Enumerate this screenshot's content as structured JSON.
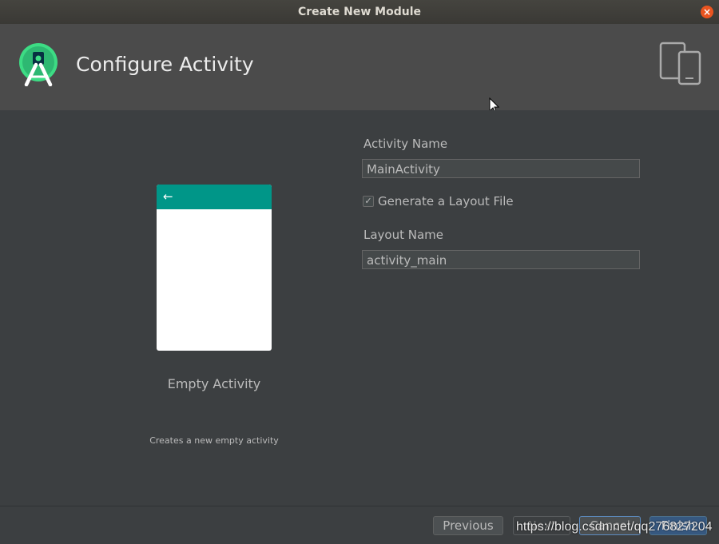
{
  "window": {
    "title": "Create New Module"
  },
  "header": {
    "title": "Configure Activity",
    "logo_icon": "android-studio-logo-icon",
    "device_icon": "phone-tablet-icon"
  },
  "template": {
    "name": "Empty Activity",
    "description": "Creates a new empty activity",
    "accent_color": "#009688"
  },
  "form": {
    "activity_name_label": "Activity Name",
    "activity_name_value": "MainActivity",
    "generate_layout_label": "Generate a Layout File",
    "generate_layout_checked": true,
    "checkbox_mark": "✓",
    "layout_name_label": "Layout Name",
    "layout_name_value": "activity_main"
  },
  "footer": {
    "previous_label": "Previous",
    "next_label": "Next",
    "cancel_label": "Cancel",
    "finish_label": "Finish",
    "watermark": "https://blog.csdn.net/qq276827204"
  },
  "colors": {
    "close_button": "#e95420",
    "finish_button": "#365880"
  }
}
